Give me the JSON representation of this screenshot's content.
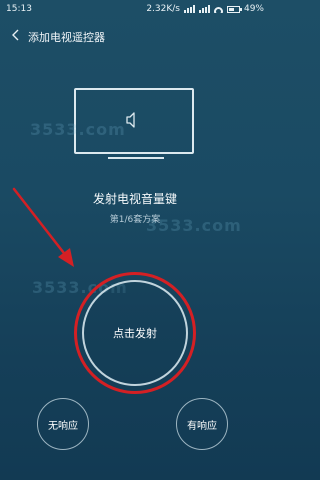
{
  "status_bar": {
    "time": "15:13",
    "speed": "2.32K/s",
    "battery": "49%"
  },
  "header": {
    "title": "添加电视遥控器"
  },
  "main": {
    "key_name": "发射电视音量键",
    "scheme": "第1/6套方案",
    "fire_button": "点击发射",
    "no_response": "无响应",
    "has_response": "有响应"
  },
  "watermarks": [
    "3533.com",
    "3533.com",
    "3533.com"
  ],
  "icons": {
    "back": "chevron-left-icon",
    "speaker": "volume-speaker-icon",
    "tv": "tv-outline-icon",
    "arrow": "red-annotation-arrow"
  },
  "colors": {
    "background": "#1a4a63",
    "annotation": "#d42024",
    "outline": "#dce9ef"
  }
}
